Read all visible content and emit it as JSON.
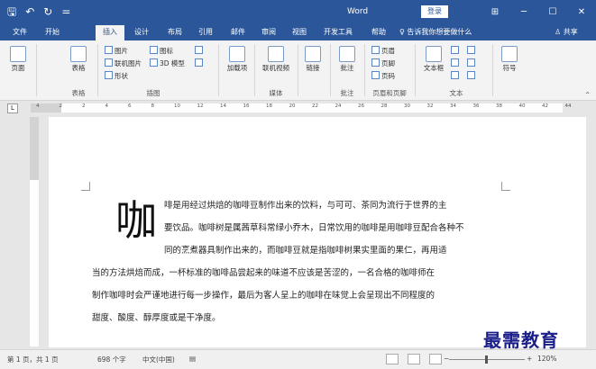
{
  "titlebar": {
    "title": "Word",
    "login": "登录",
    "qat": [
      "🖫",
      "↶",
      "↻",
      "="
    ],
    "controls": [
      "⊞",
      "─",
      "☐",
      "✕"
    ]
  },
  "tabs": [
    "文件",
    "开始",
    "插入",
    "设计",
    "布局",
    "引用",
    "邮件",
    "审阅",
    "视图",
    "开发工具",
    "帮助"
  ],
  "active_tab": "插入",
  "tellme": "♀ 告诉我你想要做什么",
  "share": "♙ 共享",
  "ribbon": {
    "page": "页面",
    "table": "表格",
    "pictures": "图片",
    "online_pictures": "联机图片",
    "shapes": "形状",
    "icons": "图标",
    "models_3d": "3D 模型",
    "smartart": "",
    "addins": "加载项",
    "online_video": "联机视频",
    "link": "链接",
    "comment": "批注",
    "header": "页眉",
    "footer": "页脚",
    "page_number": "页码",
    "textbox": "文本框",
    "symbol": "符号",
    "groups": {
      "table": "表格",
      "illustrations": "插图",
      "media": "媒体",
      "comments": "批注",
      "header_footer": "页眉和页脚",
      "text": "文本"
    }
  },
  "ruler": {
    "ticks": [
      "4",
      "2",
      "2",
      "4",
      "6",
      "8",
      "10",
      "12",
      "14",
      "16",
      "18",
      "20",
      "22",
      "24",
      "26",
      "28",
      "30",
      "32",
      "34",
      "36",
      "38",
      "40",
      "42",
      "44"
    ]
  },
  "document": {
    "dropcap": "咖",
    "lines": [
      "啡是用经过烘焙的咖啡豆制作出来的饮料，与可可、茶同为流行于世界的主",
      "要饮品。咖啡树是属茜草科常绿小乔木，日常饮用的咖啡是用咖啡豆配合各种不",
      "同的烹煮器具制作出来的，而咖啡豆就是指咖啡树果实里面的果仁，再用适",
      "当的方法烘焙而成，一杯标准的咖啡品尝起来的味道不应该是苦涩的，一名合格的咖啡师在",
      "制作咖啡时会严谨地进行每一步操作，最后为客人呈上的咖啡在味觉上会呈现出不同程度的",
      "甜度、酸度、醇厚度或是干净度。"
    ]
  },
  "watermark": "最需教育",
  "status": {
    "page": "第 1 页，共 1 页",
    "words": "698 个字",
    "language": "中文(中国)",
    "zoom": "120%"
  }
}
